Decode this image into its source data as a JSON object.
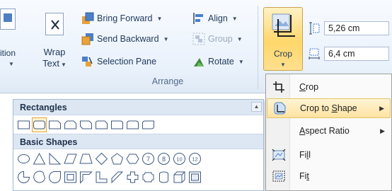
{
  "ribbon": {
    "partial_left_label": "ition",
    "wrap_text": {
      "line1": "Wrap",
      "line2": "Text"
    },
    "arrange": {
      "bring_forward": "Bring Forward",
      "send_backward": "Send Backward",
      "selection_pane": "Selection Pane",
      "align": "Align",
      "group": "Group",
      "rotate": "Rotate",
      "group_label": "Arrange"
    },
    "crop": {
      "label": "Crop"
    },
    "size": {
      "height_value": "5,26 cm",
      "width_value": "6,4 cm"
    }
  },
  "gallery": {
    "section1": "Rectangles",
    "section2": "Basic Shapes",
    "number_shapes": [
      "7",
      "8",
      "10",
      "12"
    ]
  },
  "menu": {
    "items": [
      {
        "label_pre": "",
        "label_u": "C",
        "label_post": "rop"
      },
      {
        "label_pre": "Crop to ",
        "label_u": "S",
        "label_post": "hape"
      },
      {
        "label_pre": "",
        "label_u": "A",
        "label_post": "spect Ratio"
      },
      {
        "label_pre": "Fi",
        "label_u": "l",
        "label_post": "l"
      },
      {
        "label_pre": "Fi",
        "label_u": "t",
        "label_post": ""
      }
    ]
  },
  "colors": {
    "accent_highlight": "#ffe3a0",
    "ribbon_text": "#1e395b"
  }
}
